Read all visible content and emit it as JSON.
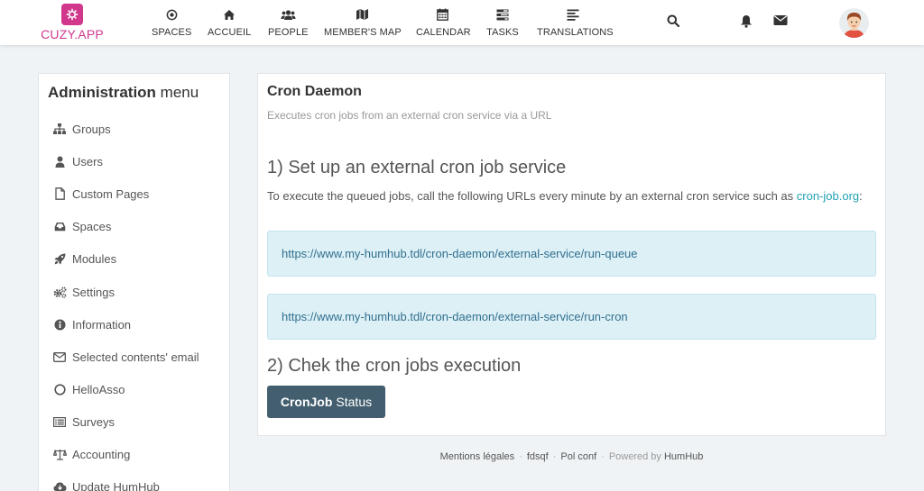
{
  "brand": {
    "name": "CUZY.APP",
    "color": "#d1388c"
  },
  "nav": {
    "items": [
      {
        "label": "SPACES",
        "icon": "dot-circle-icon"
      },
      {
        "label": "ACCUEIL",
        "icon": "home-icon"
      },
      {
        "label": "PEOPLE",
        "icon": "users-icon"
      },
      {
        "label": "MEMBER'S MAP",
        "icon": "map-icon"
      },
      {
        "label": "CALENDAR",
        "icon": "calendar-icon"
      },
      {
        "label": "TASKS",
        "icon": "tasks-icon"
      },
      {
        "label": "TRANSLATIONS",
        "icon": "align-left-icon"
      }
    ]
  },
  "topicons": [
    "search-icon",
    "bell-icon",
    "envelope-icon"
  ],
  "sidebar": {
    "title_bold": "Administration",
    "title_rest": " menu",
    "items": [
      {
        "label": "Groups",
        "icon": "sitemap-icon"
      },
      {
        "label": "Users",
        "icon": "user-icon"
      },
      {
        "label": "Custom Pages",
        "icon": "file-icon"
      },
      {
        "label": "Spaces",
        "icon": "inbox-icon"
      },
      {
        "label": "Modules",
        "icon": "rocket-icon"
      },
      {
        "label": "Settings",
        "icon": "cogs-icon"
      },
      {
        "label": "Information",
        "icon": "info-circle-icon"
      },
      {
        "label": "Selected contents' email",
        "icon": "envelope-o-icon"
      },
      {
        "label": "HelloAsso",
        "icon": "circle-o-icon"
      },
      {
        "label": "Surveys",
        "icon": "list-icon"
      },
      {
        "label": "Accounting",
        "icon": "balance-scale-icon"
      },
      {
        "label": "Update HumHub",
        "icon": "cloud-download-icon"
      }
    ]
  },
  "main": {
    "title": "Cron Daemon",
    "subtitle": "Executes cron jobs from an external cron service via a URL",
    "step1_heading": "1) Set up an external cron job service",
    "step1_text": "To execute the queued jobs, call the following URLs every minute by an external cron service such as ",
    "step1_link": "cron-job.org",
    "step1_suffix": ":",
    "urls": [
      "https://www.my-humhub.tdl/cron-daemon/external-service/run-queue",
      "https://www.my-humhub.tdl/cron-daemon/external-service/run-cron"
    ],
    "step2_heading": "2) Chek the cron jobs execution",
    "button_bold": "CronJob",
    "button_rest": "Status"
  },
  "footer": {
    "links": [
      "Mentions légales",
      "fdsqf",
      "Pol conf"
    ],
    "powered_prefix": "Powered by ",
    "powered_name": "HumHub"
  }
}
